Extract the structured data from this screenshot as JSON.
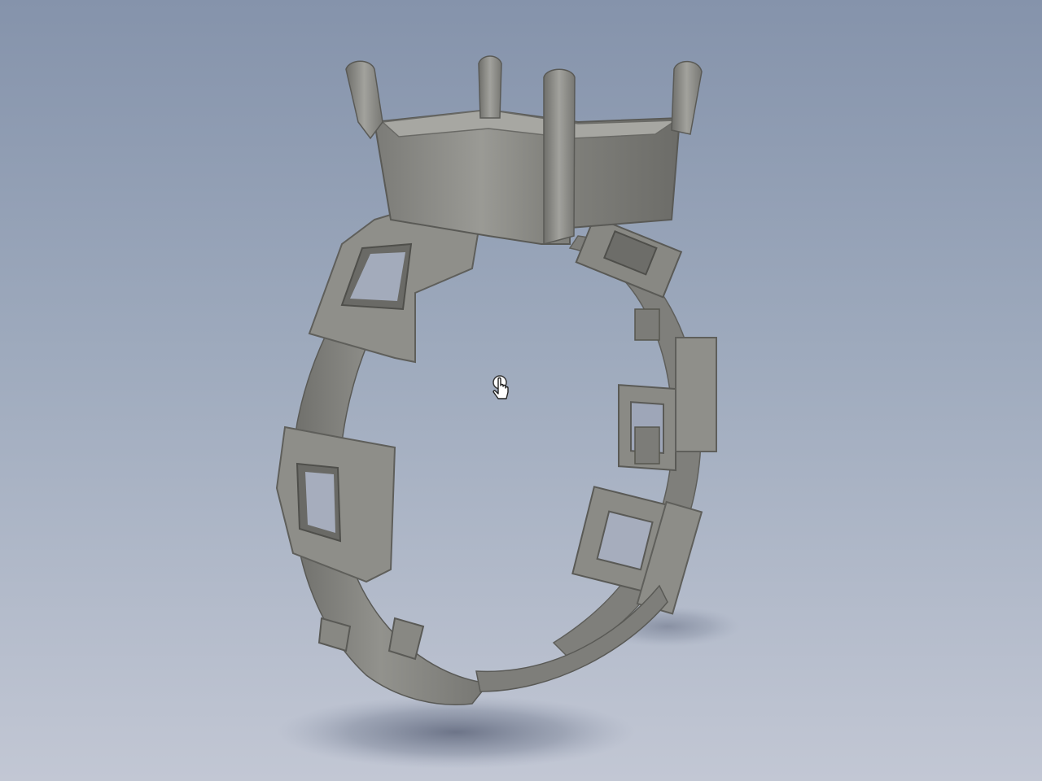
{
  "viewport": {
    "background_top": "#8593ab",
    "background_bottom": "#c2c7d4"
  },
  "model": {
    "material_color": "#8b8b86",
    "shadow_color": "#525a70"
  },
  "cursor": {
    "icon": "hand-pointer-rotate-icon"
  }
}
